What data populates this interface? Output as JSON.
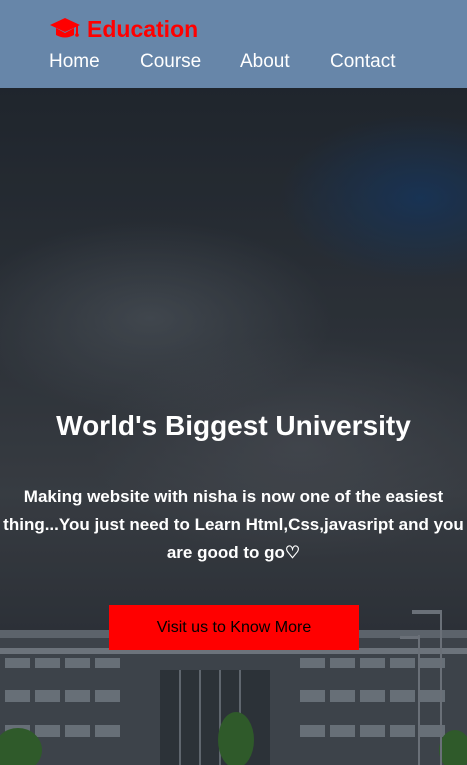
{
  "brand": {
    "name": "Education",
    "icon": "graduation-cap-icon",
    "color": "#ff0000"
  },
  "nav": {
    "items": [
      {
        "label": "Home"
      },
      {
        "label": "Course"
      },
      {
        "label": "About"
      },
      {
        "label": "Contact"
      }
    ]
  },
  "hero": {
    "title": "World's Biggest University",
    "text": "Making website with nisha is now one of the easiest thing...You just need to Learn Html,Css,javasript and you are good to go♡",
    "cta_label": "Visit us to Know More"
  },
  "colors": {
    "header_bg": "#6786a9",
    "accent": "#ff0000",
    "hero_text": "#ffffff"
  }
}
